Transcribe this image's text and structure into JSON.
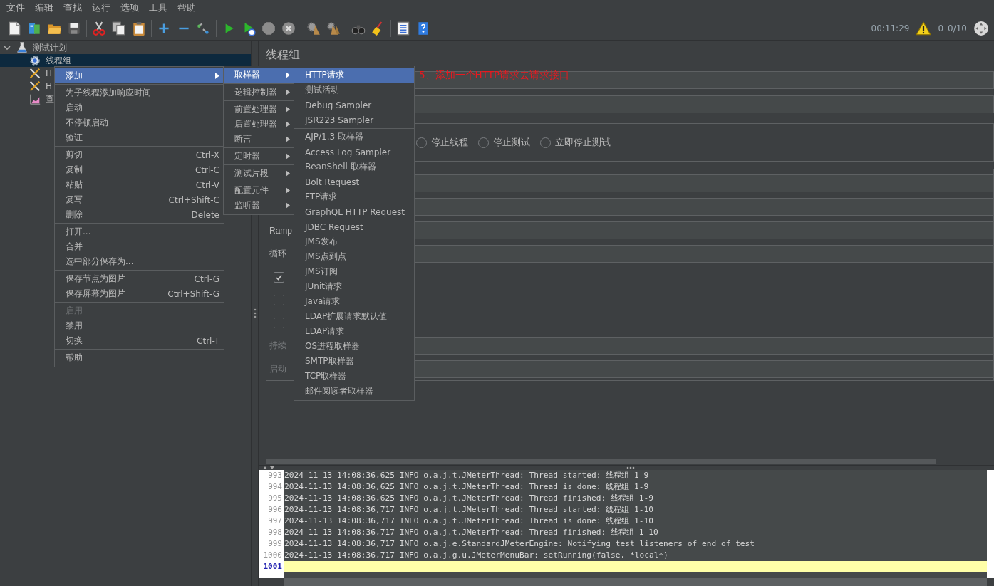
{
  "menu_bar": [
    "文件",
    "编辑",
    "查找",
    "运行",
    "选项",
    "工具",
    "帮助"
  ],
  "status": {
    "elapsed": "00:11:29",
    "warnings": "0",
    "threads": "0/10"
  },
  "tree": [
    {
      "label": "测试计划",
      "kind": "plan",
      "expanded": true,
      "selected": false,
      "children": [
        {
          "label": "线程组",
          "kind": "thread-group",
          "selected": true
        },
        {
          "label": "H",
          "kind": "sampler",
          "selected": false
        },
        {
          "label": "H",
          "kind": "sampler",
          "selected": false
        },
        {
          "label": "查",
          "kind": "listener",
          "selected": false
        }
      ]
    }
  ],
  "panel": {
    "title": "线程组",
    "top_rows": [
      {
        "kind": "field"
      },
      {
        "kind": "field"
      }
    ],
    "radios": [
      {
        "label": "停止线程",
        "selected": false
      },
      {
        "label": "停止测试",
        "selected": false
      },
      {
        "label": "立即停止测试",
        "selected": false
      }
    ],
    "rows": [
      {
        "kind": "field"
      },
      {
        "kind": "field"
      },
      {
        "kind": "field",
        "label": "Ramp",
        "disabled": false
      },
      {
        "kind": "field",
        "label": "循环",
        "disabled": false
      },
      {
        "kind": "checkbox",
        "checked": true
      },
      {
        "kind": "checkbox",
        "checked": false
      },
      {
        "kind": "checkbox",
        "checked": false
      },
      {
        "kind": "field",
        "label": "持续",
        "disabled": true
      },
      {
        "kind": "field",
        "label": "启动",
        "disabled": true
      }
    ]
  },
  "context_menu": {
    "groups": [
      {
        "items": [
          {
            "label": "添加",
            "selected": true,
            "disabled": false,
            "submenu": true
          }
        ]
      },
      {
        "items": [
          {
            "label": "为子线程添加响应时间",
            "selected": false,
            "disabled": false,
            "submenu": false
          },
          {
            "label": "启动",
            "selected": false,
            "disabled": false,
            "submenu": false
          },
          {
            "label": "不停顿启动",
            "selected": false,
            "disabled": false,
            "submenu": false
          },
          {
            "label": "验证",
            "selected": false,
            "disabled": false,
            "submenu": false
          }
        ]
      },
      {
        "items": [
          {
            "label": "剪切",
            "shortcut": "Ctrl-X",
            "selected": false,
            "disabled": false,
            "submenu": false
          },
          {
            "label": "复制",
            "shortcut": "Ctrl-C",
            "selected": false,
            "disabled": false,
            "submenu": false
          },
          {
            "label": "粘贴",
            "shortcut": "Ctrl-V",
            "selected": false,
            "disabled": false,
            "submenu": false
          },
          {
            "label": "复写",
            "shortcut": "Ctrl+Shift-C",
            "selected": false,
            "disabled": false,
            "submenu": false
          },
          {
            "label": "删除",
            "shortcut": "Delete",
            "selected": false,
            "disabled": false,
            "submenu": false
          }
        ]
      },
      {
        "items": [
          {
            "label": "打开...",
            "selected": false,
            "disabled": false,
            "submenu": false
          },
          {
            "label": "合并",
            "selected": false,
            "disabled": false,
            "submenu": false
          },
          {
            "label": "选中部分保存为...",
            "selected": false,
            "disabled": false,
            "submenu": false
          }
        ]
      },
      {
        "items": [
          {
            "label": "保存节点为图片",
            "shortcut": "Ctrl-G",
            "selected": false,
            "disabled": false,
            "submenu": false
          },
          {
            "label": "保存屏幕为图片",
            "shortcut": "Ctrl+Shift-G",
            "selected": false,
            "disabled": false,
            "submenu": false
          }
        ]
      },
      {
        "items": [
          {
            "label": "启用",
            "selected": false,
            "disabled": true,
            "submenu": false
          },
          {
            "label": "禁用",
            "selected": false,
            "disabled": false,
            "submenu": false
          },
          {
            "label": "切换",
            "shortcut": "Ctrl-T",
            "selected": false,
            "disabled": false,
            "submenu": false
          }
        ]
      },
      {
        "items": [
          {
            "label": "帮助",
            "selected": false,
            "disabled": false,
            "submenu": false
          }
        ]
      }
    ]
  },
  "add_submenu": {
    "groups": [
      {
        "items": [
          {
            "label": "取样器",
            "selected": true,
            "disabled": false,
            "submenu": true
          }
        ]
      },
      {
        "items": [
          {
            "label": "逻辑控制器",
            "selected": false,
            "disabled": false,
            "submenu": true
          }
        ]
      },
      {
        "items": [
          {
            "label": "前置处理器",
            "selected": false,
            "disabled": false,
            "submenu": true
          },
          {
            "label": "后置处理器",
            "selected": false,
            "disabled": false,
            "submenu": true
          },
          {
            "label": "断言",
            "selected": false,
            "disabled": false,
            "submenu": true
          }
        ]
      },
      {
        "items": [
          {
            "label": "定时器",
            "selected": false,
            "disabled": false,
            "submenu": true
          }
        ]
      },
      {
        "items": [
          {
            "label": "测试片段",
            "selected": false,
            "disabled": false,
            "submenu": true
          }
        ]
      },
      {
        "items": [
          {
            "label": "配置元件",
            "selected": false,
            "disabled": false,
            "submenu": true
          },
          {
            "label": "监听器",
            "selected": false,
            "disabled": false,
            "submenu": true
          }
        ]
      }
    ]
  },
  "sampler_submenu": {
    "groups": [
      {
        "items": [
          {
            "label": "HTTP请求",
            "selected": true,
            "disabled": false,
            "submenu": false
          },
          {
            "label": "测试活动",
            "selected": false,
            "disabled": false,
            "submenu": false
          },
          {
            "label": "Debug Sampler",
            "selected": false,
            "disabled": false,
            "submenu": false
          },
          {
            "label": "JSR223 Sampler",
            "selected": false,
            "disabled": false,
            "submenu": false
          }
        ]
      },
      {
        "items": [
          {
            "label": "AJP/1.3 取样器",
            "selected": false,
            "disabled": false,
            "submenu": false
          },
          {
            "label": "Access Log Sampler",
            "selected": false,
            "disabled": false,
            "submenu": false
          },
          {
            "label": "BeanShell 取样器",
            "selected": false,
            "disabled": false,
            "submenu": false
          },
          {
            "label": "Bolt Request",
            "selected": false,
            "disabled": false,
            "submenu": false
          },
          {
            "label": "FTP请求",
            "selected": false,
            "disabled": false,
            "submenu": false
          },
          {
            "label": "GraphQL HTTP Request",
            "selected": false,
            "disabled": false,
            "submenu": false
          },
          {
            "label": "JDBC Request",
            "selected": false,
            "disabled": false,
            "submenu": false
          },
          {
            "label": "JMS发布",
            "selected": false,
            "disabled": false,
            "submenu": false
          },
          {
            "label": "JMS点到点",
            "selected": false,
            "disabled": false,
            "submenu": false
          },
          {
            "label": "JMS订阅",
            "selected": false,
            "disabled": false,
            "submenu": false
          },
          {
            "label": "JUnit请求",
            "selected": false,
            "disabled": false,
            "submenu": false
          },
          {
            "label": "Java请求",
            "selected": false,
            "disabled": false,
            "submenu": false
          },
          {
            "label": "LDAP扩展请求默认值",
            "selected": false,
            "disabled": false,
            "submenu": false
          },
          {
            "label": "LDAP请求",
            "selected": false,
            "disabled": false,
            "submenu": false
          },
          {
            "label": "OS进程取样器",
            "selected": false,
            "disabled": false,
            "submenu": false
          },
          {
            "label": "SMTP取样器",
            "selected": false,
            "disabled": false,
            "submenu": false
          },
          {
            "label": "TCP取样器",
            "selected": false,
            "disabled": false,
            "submenu": false
          },
          {
            "label": "邮件阅读者取样器",
            "selected": false,
            "disabled": false,
            "submenu": false
          }
        ]
      }
    ]
  },
  "annotation": "5、添加一个HTTP请求去请求接口",
  "log": {
    "lines": [
      {
        "number": "993",
        "text": "2024-11-13 14:08:36,625 INFO o.a.j.t.JMeterThread: Thread started: 线程组 1-9",
        "selected": false
      },
      {
        "number": "994",
        "text": "2024-11-13 14:08:36,625 INFO o.a.j.t.JMeterThread: Thread is done: 线程组 1-9",
        "selected": false
      },
      {
        "number": "995",
        "text": "2024-11-13 14:08:36,625 INFO o.a.j.t.JMeterThread: Thread finished: 线程组 1-9",
        "selected": false
      },
      {
        "number": "996",
        "text": "2024-11-13 14:08:36,717 INFO o.a.j.t.JMeterThread: Thread started: 线程组 1-10",
        "selected": false
      },
      {
        "number": "997",
        "text": "2024-11-13 14:08:36,717 INFO o.a.j.t.JMeterThread: Thread is done: 线程组 1-10",
        "selected": false
      },
      {
        "number": "998",
        "text": "2024-11-13 14:08:36,717 INFO o.a.j.t.JMeterThread: Thread finished: 线程组 1-10",
        "selected": false
      },
      {
        "number": "999",
        "text": "2024-11-13 14:08:36,717 INFO o.a.j.e.StandardJMeterEngine: Notifying test listeners of end of test",
        "selected": false
      },
      {
        "number": "1000",
        "text": "2024-11-13 14:08:36,717 INFO o.a.j.g.u.JMeterMenuBar: setRunning(false, *local*)",
        "selected": false
      },
      {
        "number": "1001",
        "selected": true
      }
    ]
  }
}
